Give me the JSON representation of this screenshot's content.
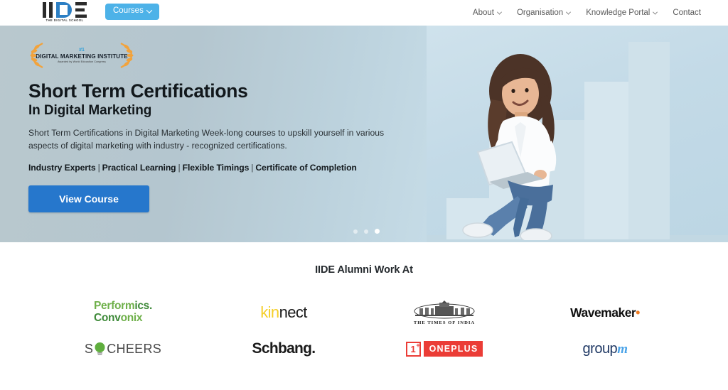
{
  "header": {
    "logo": {
      "mark": "IIDE",
      "tagline": "THE DIGITAL SCHOOL"
    },
    "courses_button": {
      "label": "Courses",
      "icon": "chevron-down-icon",
      "color": "#4db2e8"
    },
    "nav": [
      {
        "label": "About",
        "has_dropdown": true
      },
      {
        "label": "Organisation",
        "has_dropdown": true
      },
      {
        "label": "Knowledge Portal",
        "has_dropdown": true
      },
      {
        "label": "Contact",
        "has_dropdown": false
      }
    ]
  },
  "hero": {
    "badge": {
      "rank": "#1",
      "title": "DIGITAL MARKETING INSTITUTE",
      "subtitle": "Awarded by World Education Congress"
    },
    "heading_line1": "Short Term Certifications",
    "heading_line2": "In Digital Marketing",
    "description": "Short Term Certifications in Digital Marketing Week-long courses to upskill yourself in various aspects of digital marketing with industry - recognized certifications.",
    "features": [
      "Industry Experts",
      "Practical Learning",
      "Flexible Timings",
      "Certificate of Completion"
    ],
    "feature_separator": "|",
    "cta": {
      "label": "View Course",
      "color": "#2677cc"
    },
    "carousel": {
      "slides": 3,
      "active_index": 2
    },
    "image_alt": "Woman with curly hair sitting on ascending blocks using a laptop"
  },
  "alumni": {
    "title": "IIDE Alumni Work At",
    "logos": [
      {
        "name": "performics-convonix-logo",
        "line1": "Perform",
        "line1b": "ics.",
        "line2": "Conv",
        "line2b": "onix"
      },
      {
        "name": "kinnect-logo",
        "part1": "kin",
        "part2": "nect"
      },
      {
        "name": "times-of-india-logo",
        "text": "THE TIMES OF INDIA"
      },
      {
        "name": "wavemaker-logo",
        "text": "Wavemaker",
        "dot": "•"
      },
      {
        "name": "socheers-logo",
        "pre": "S",
        "post": "CHEERS"
      },
      {
        "name": "schbang-logo",
        "text": "Schbang."
      },
      {
        "name": "oneplus-logo",
        "mark": "1",
        "plus": "+",
        "word": "ONEPLUS"
      },
      {
        "name": "groupm-logo",
        "part1": "group",
        "part2": "m"
      }
    ]
  }
}
